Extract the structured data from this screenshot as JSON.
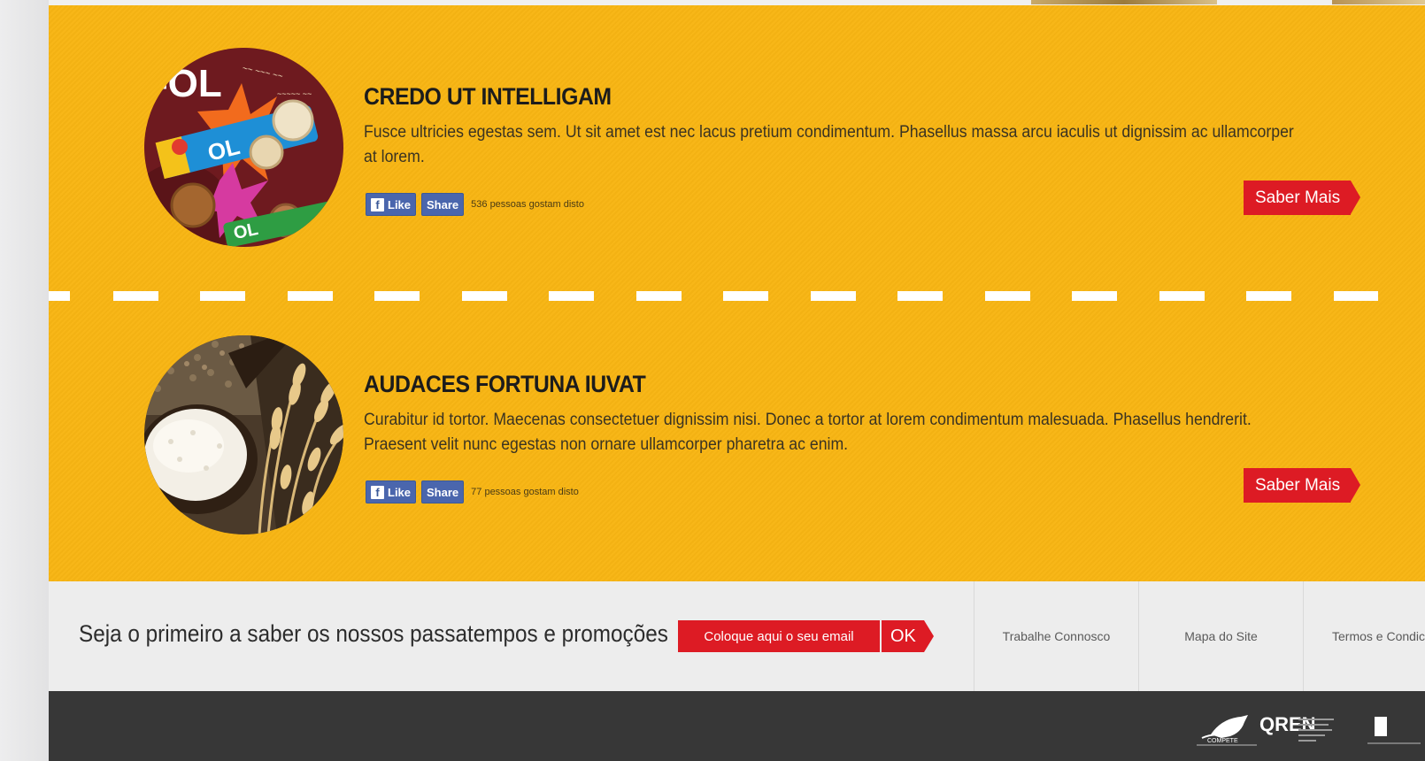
{
  "products": [
    {
      "title": "CREDO UT INTELLIGAM",
      "description": "Fusce ultricies egestas sem. Ut sit amet est nec lacus pretium condimentum. Phasellus massa arcu iaculis ut dignissim ac ullamcorper at lorem.",
      "like_label": "Like",
      "share_label": "Share",
      "likes_text": "536 pessoas gostam disto",
      "cta_label": "Saber Mais",
      "image": "cookie-biscuit-packages"
    },
    {
      "title": "AUDACES FORTUNA IUVAT",
      "description": "Curabitur id tortor. Maecenas consectetuer dignissim nisi. Donec a tortor at lorem condimentum malesuada. Phasellus hendrerit. Praesent velit nunc egestas non ornare ullamcorper pharetra ac enim.",
      "like_label": "Like",
      "share_label": "Share",
      "likes_text": "77 pessoas gostam disto",
      "cta_label": "Saber Mais",
      "image": "flour-scoop-and-wheat"
    }
  ],
  "newsletter": {
    "text": "Seja o primeiro a saber os nossos passatempos e promoções",
    "email_placeholder": "Coloque aqui o seu email",
    "submit_label": "OK"
  },
  "footer_links": [
    "Trabalhe Connosco",
    "Mapa do Site",
    "Termos e Condic"
  ],
  "footer_logos": [
    "COMPETE",
    "QREN",
    ""
  ],
  "colors": {
    "accent_yellow": "#f8b513",
    "cta_red": "#dd1b24",
    "facebook_blue": "#4a66ad",
    "footer_dark": "#373737",
    "bar_light": "#ededed"
  }
}
